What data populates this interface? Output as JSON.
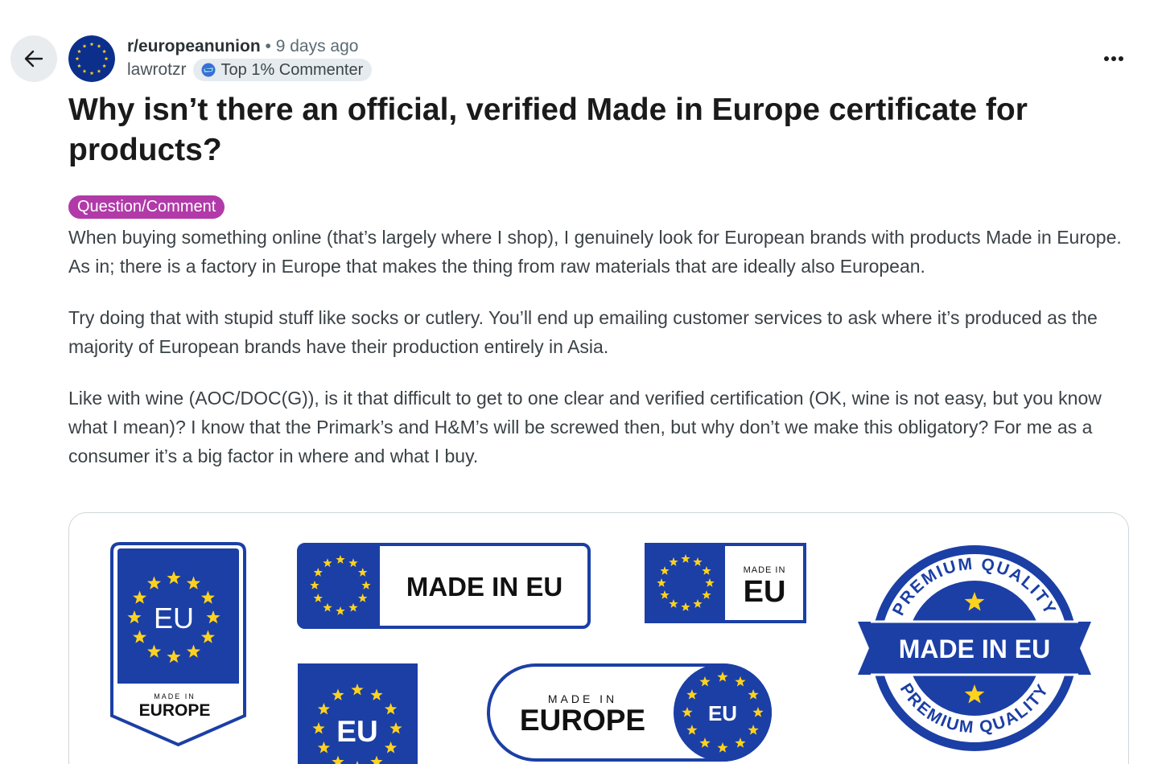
{
  "nav": {
    "back_icon": "arrow-left-icon",
    "more_icon": "ellipsis-horizontal-icon"
  },
  "post": {
    "subreddit": "r/europeanunion",
    "time": "• 9 days ago",
    "author": "lawrotzr",
    "badge": "Top 1% Commenter",
    "title": "Why isn’t there an official, verified Made in Europe certificate for products?",
    "flair": "Question/Comment",
    "paragraphs": [
      "When buying something online (that’s largely where I shop), I genuinely look for European brands with products Made in Europe. As in; there is a factory in Europe that makes the thing from raw materials that are ideally also European.",
      "Try doing that with stupid stuff like socks or cutlery. You’ll end up emailing customer services to ask where it’s produced as the majority of European brands have their production entirely in Asia.",
      "Like with wine (AOC/DOC(G)), is it that difficult to get to one clear and verified certification (OK, wine is not easy, but you know what I mean)? I know that the Primark’s and H&M’s will be screwed then, but why don’t we make this obligatory? For me as a consumer it’s a big factor in where and what I buy."
    ]
  },
  "image": {
    "shield_label": "EU",
    "shield_small": "MADE IN",
    "shield_big": "EUROPE",
    "banner_wide": "MADE IN EU",
    "small_tag_small": "MADE IN",
    "small_tag_big": "EU",
    "square_label": "EU",
    "pill_small": "MADE IN",
    "pill_big": "EUROPE",
    "pill_circle": "EU",
    "seal_top": "PREMIUM QUALITY",
    "seal_center": "MADE IN EU",
    "seal_bottom": "PREMIUM QUALITY"
  },
  "colors": {
    "eu_blue": "#1b3fa5",
    "eu_yellow": "#ffd21f",
    "flair": "#b13aa8"
  }
}
